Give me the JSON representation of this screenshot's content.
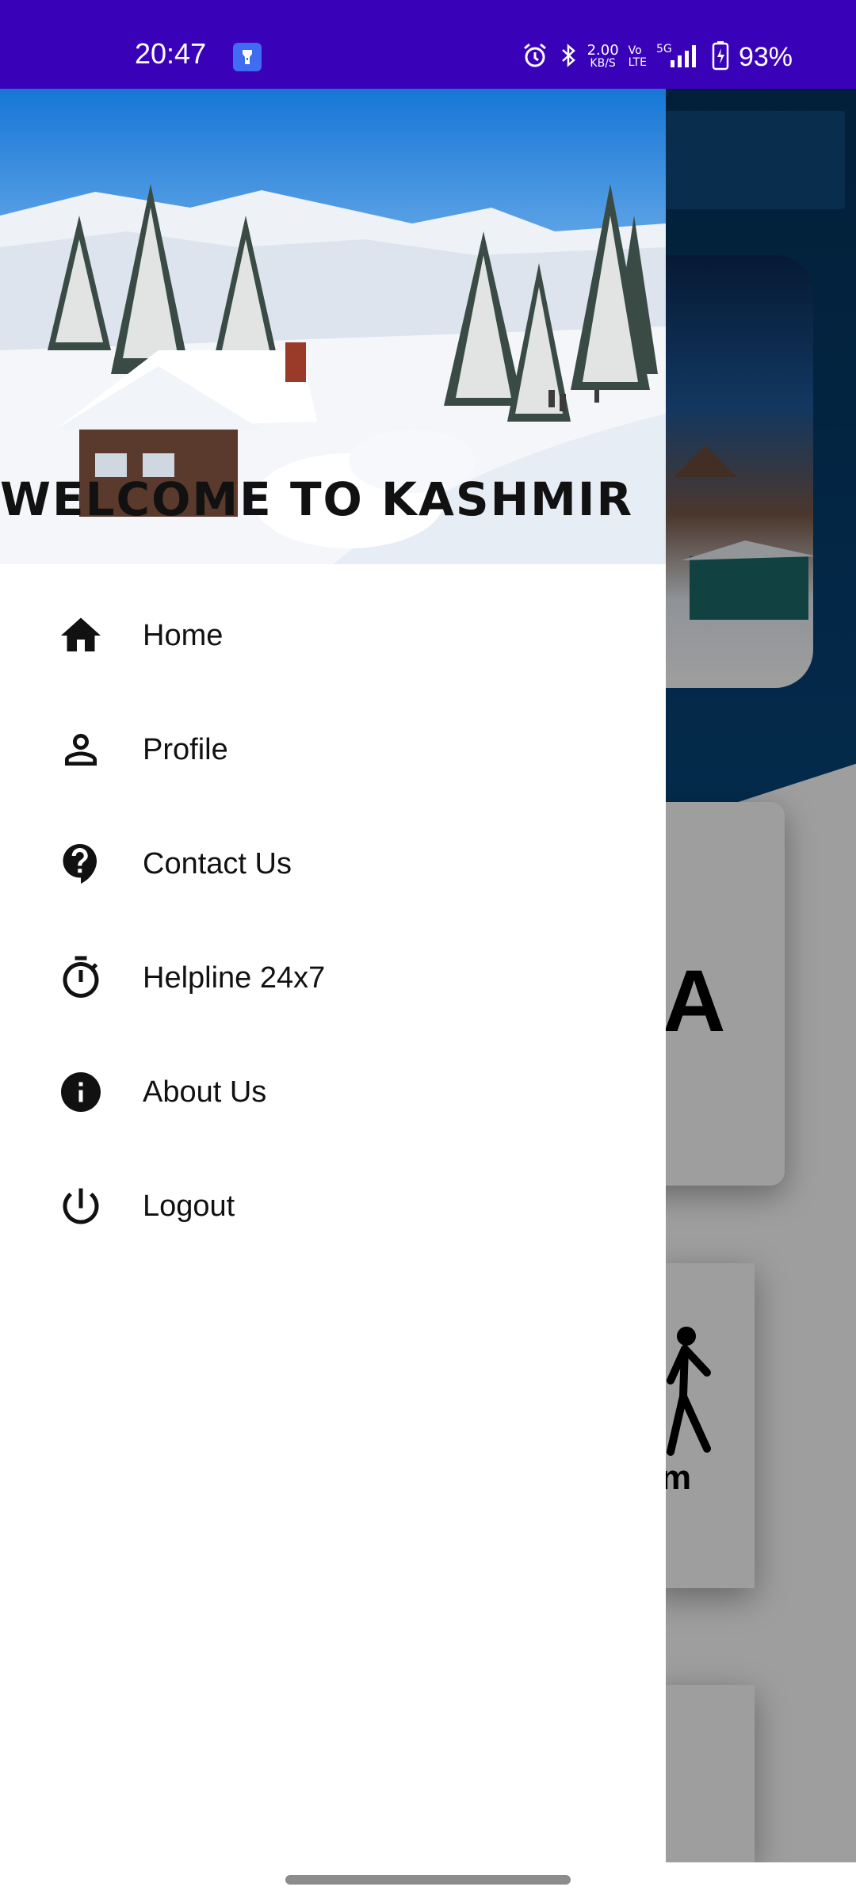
{
  "status_bar": {
    "time": "20:47",
    "net_speed_value": "2.00",
    "net_speed_unit": "KB/S",
    "volte_top": "Vo",
    "volte_bottom": "LTE",
    "network_type": "5G",
    "battery_percent": "93%",
    "icons": [
      "flashlight-icon",
      "alarm-icon",
      "bluetooth-icon",
      "signal-icon",
      "battery-icon"
    ]
  },
  "drawer": {
    "header_title": "Welcome to Kashmir",
    "items": [
      {
        "label": "Home",
        "icon": "home-icon"
      },
      {
        "label": "Profile",
        "icon": "profile-icon"
      },
      {
        "label": "Contact Us",
        "icon": "help-icon"
      },
      {
        "label": "Helpline 24x7",
        "icon": "timer-icon"
      },
      {
        "label": "About Us",
        "icon": "info-icon"
      },
      {
        "label": "Logout",
        "icon": "power-icon"
      }
    ]
  },
  "background": {
    "partial_card_text": "m",
    "partial_card_glyph": "A"
  },
  "colors": {
    "status_bar": "#3a02b8",
    "drawer_bg": "#ffffff",
    "text": "#111111"
  }
}
